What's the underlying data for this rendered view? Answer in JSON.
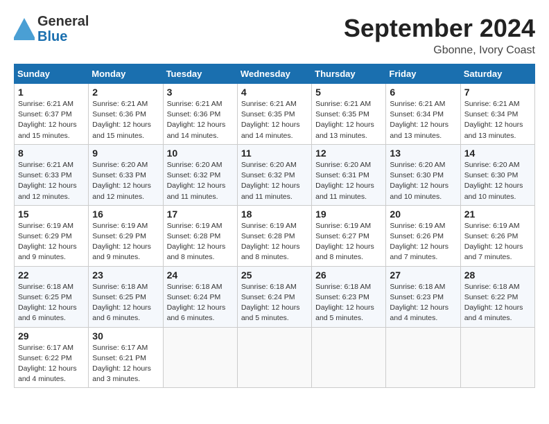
{
  "header": {
    "logo_general": "General",
    "logo_blue": "Blue",
    "month": "September 2024",
    "location": "Gbonne, Ivory Coast"
  },
  "days_of_week": [
    "Sunday",
    "Monday",
    "Tuesday",
    "Wednesday",
    "Thursday",
    "Friday",
    "Saturday"
  ],
  "weeks": [
    [
      {
        "day": "1",
        "sunrise": "6:21 AM",
        "sunset": "6:37 PM",
        "daylight": "12 hours and 15 minutes."
      },
      {
        "day": "2",
        "sunrise": "6:21 AM",
        "sunset": "6:36 PM",
        "daylight": "12 hours and 15 minutes."
      },
      {
        "day": "3",
        "sunrise": "6:21 AM",
        "sunset": "6:36 PM",
        "daylight": "12 hours and 14 minutes."
      },
      {
        "day": "4",
        "sunrise": "6:21 AM",
        "sunset": "6:35 PM",
        "daylight": "12 hours and 14 minutes."
      },
      {
        "day": "5",
        "sunrise": "6:21 AM",
        "sunset": "6:35 PM",
        "daylight": "12 hours and 13 minutes."
      },
      {
        "day": "6",
        "sunrise": "6:21 AM",
        "sunset": "6:34 PM",
        "daylight": "12 hours and 13 minutes."
      },
      {
        "day": "7",
        "sunrise": "6:21 AM",
        "sunset": "6:34 PM",
        "daylight": "12 hours and 13 minutes."
      }
    ],
    [
      {
        "day": "8",
        "sunrise": "6:21 AM",
        "sunset": "6:33 PM",
        "daylight": "12 hours and 12 minutes."
      },
      {
        "day": "9",
        "sunrise": "6:20 AM",
        "sunset": "6:33 PM",
        "daylight": "12 hours and 12 minutes."
      },
      {
        "day": "10",
        "sunrise": "6:20 AM",
        "sunset": "6:32 PM",
        "daylight": "12 hours and 11 minutes."
      },
      {
        "day": "11",
        "sunrise": "6:20 AM",
        "sunset": "6:32 PM",
        "daylight": "12 hours and 11 minutes."
      },
      {
        "day": "12",
        "sunrise": "6:20 AM",
        "sunset": "6:31 PM",
        "daylight": "12 hours and 11 minutes."
      },
      {
        "day": "13",
        "sunrise": "6:20 AM",
        "sunset": "6:30 PM",
        "daylight": "12 hours and 10 minutes."
      },
      {
        "day": "14",
        "sunrise": "6:20 AM",
        "sunset": "6:30 PM",
        "daylight": "12 hours and 10 minutes."
      }
    ],
    [
      {
        "day": "15",
        "sunrise": "6:19 AM",
        "sunset": "6:29 PM",
        "daylight": "12 hours and 9 minutes."
      },
      {
        "day": "16",
        "sunrise": "6:19 AM",
        "sunset": "6:29 PM",
        "daylight": "12 hours and 9 minutes."
      },
      {
        "day": "17",
        "sunrise": "6:19 AM",
        "sunset": "6:28 PM",
        "daylight": "12 hours and 8 minutes."
      },
      {
        "day": "18",
        "sunrise": "6:19 AM",
        "sunset": "6:28 PM",
        "daylight": "12 hours and 8 minutes."
      },
      {
        "day": "19",
        "sunrise": "6:19 AM",
        "sunset": "6:27 PM",
        "daylight": "12 hours and 8 minutes."
      },
      {
        "day": "20",
        "sunrise": "6:19 AM",
        "sunset": "6:26 PM",
        "daylight": "12 hours and 7 minutes."
      },
      {
        "day": "21",
        "sunrise": "6:19 AM",
        "sunset": "6:26 PM",
        "daylight": "12 hours and 7 minutes."
      }
    ],
    [
      {
        "day": "22",
        "sunrise": "6:18 AM",
        "sunset": "6:25 PM",
        "daylight": "12 hours and 6 minutes."
      },
      {
        "day": "23",
        "sunrise": "6:18 AM",
        "sunset": "6:25 PM",
        "daylight": "12 hours and 6 minutes."
      },
      {
        "day": "24",
        "sunrise": "6:18 AM",
        "sunset": "6:24 PM",
        "daylight": "12 hours and 6 minutes."
      },
      {
        "day": "25",
        "sunrise": "6:18 AM",
        "sunset": "6:24 PM",
        "daylight": "12 hours and 5 minutes."
      },
      {
        "day": "26",
        "sunrise": "6:18 AM",
        "sunset": "6:23 PM",
        "daylight": "12 hours and 5 minutes."
      },
      {
        "day": "27",
        "sunrise": "6:18 AM",
        "sunset": "6:23 PM",
        "daylight": "12 hours and 4 minutes."
      },
      {
        "day": "28",
        "sunrise": "6:18 AM",
        "sunset": "6:22 PM",
        "daylight": "12 hours and 4 minutes."
      }
    ],
    [
      {
        "day": "29",
        "sunrise": "6:17 AM",
        "sunset": "6:22 PM",
        "daylight": "12 hours and 4 minutes."
      },
      {
        "day": "30",
        "sunrise": "6:17 AM",
        "sunset": "6:21 PM",
        "daylight": "12 hours and 3 minutes."
      },
      null,
      null,
      null,
      null,
      null
    ]
  ],
  "labels": {
    "sunrise": "Sunrise:",
    "sunset": "Sunset:",
    "daylight": "Daylight:"
  }
}
